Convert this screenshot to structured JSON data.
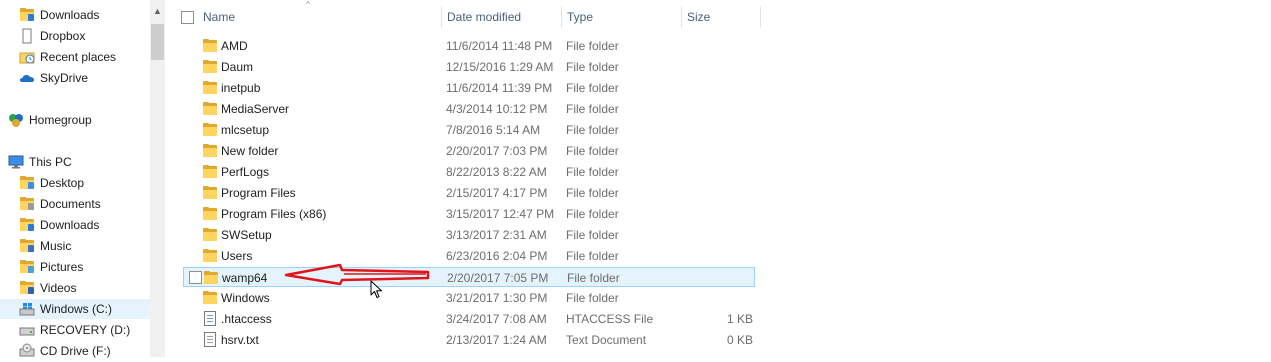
{
  "nav_pane": {
    "items": [
      {
        "label": "Downloads",
        "icon": "downloads-folder-icon"
      },
      {
        "label": "Dropbox",
        "icon": "dropbox-icon"
      },
      {
        "label": "Recent places",
        "icon": "recent-places-icon"
      },
      {
        "label": "SkyDrive",
        "icon": "skydrive-icon"
      },
      {
        "label": "Homegroup",
        "icon": "homegroup-icon"
      },
      {
        "label": "This PC",
        "icon": "this-pc-icon"
      },
      {
        "label": "Desktop",
        "icon": "desktop-folder-icon"
      },
      {
        "label": "Documents",
        "icon": "documents-folder-icon"
      },
      {
        "label": "Downloads",
        "icon": "downloads-folder-icon"
      },
      {
        "label": "Music",
        "icon": "music-folder-icon"
      },
      {
        "label": "Pictures",
        "icon": "pictures-folder-icon"
      },
      {
        "label": "Videos",
        "icon": "videos-folder-icon"
      },
      {
        "label": "Windows (C:)",
        "icon": "windows-drive-icon",
        "selected": true
      },
      {
        "label": "RECOVERY (D:)",
        "icon": "drive-icon"
      },
      {
        "label": "CD Drive (F:)",
        "icon": "cd-drive-icon"
      }
    ],
    "scroll_up_glyph": "▲"
  },
  "file_list": {
    "columns": {
      "name": "Name",
      "date_modified": "Date modified",
      "type": "Type",
      "size": "Size"
    },
    "sort_glyph": "^",
    "rows": [
      {
        "name": "AMD",
        "date": "11/6/2014 11:48 PM",
        "type": "File folder",
        "size": "",
        "icon": "folder-icon"
      },
      {
        "name": "Daum",
        "date": "12/15/2016 1:29 AM",
        "type": "File folder",
        "size": "",
        "icon": "folder-icon"
      },
      {
        "name": "inetpub",
        "date": "11/6/2014 11:39 PM",
        "type": "File folder",
        "size": "",
        "icon": "folder-icon"
      },
      {
        "name": "MediaServer",
        "date": "4/3/2014 10:12 PM",
        "type": "File folder",
        "size": "",
        "icon": "folder-icon"
      },
      {
        "name": "mlcsetup",
        "date": "7/8/2016 5:14 AM",
        "type": "File folder",
        "size": "",
        "icon": "folder-icon"
      },
      {
        "name": "New folder",
        "date": "2/20/2017 7:03 PM",
        "type": "File folder",
        "size": "",
        "icon": "folder-icon"
      },
      {
        "name": "PerfLogs",
        "date": "8/22/2013 8:22 AM",
        "type": "File folder",
        "size": "",
        "icon": "folder-icon"
      },
      {
        "name": "Program Files",
        "date": "2/15/2017 4:17 PM",
        "type": "File folder",
        "size": "",
        "icon": "folder-icon"
      },
      {
        "name": "Program Files (x86)",
        "date": "3/15/2017 12:47 PM",
        "type": "File folder",
        "size": "",
        "icon": "folder-icon"
      },
      {
        "name": "SWSetup",
        "date": "3/13/2017 2:31 AM",
        "type": "File folder",
        "size": "",
        "icon": "folder-icon"
      },
      {
        "name": "Users",
        "date": "6/23/2016 2:04 PM",
        "type": "File folder",
        "size": "",
        "icon": "folder-icon"
      },
      {
        "name": "wamp64",
        "date": "2/20/2017 7:05 PM",
        "type": "File folder",
        "size": "",
        "icon": "folder-icon",
        "selected": true
      },
      {
        "name": "Windows",
        "date": "3/21/2017 1:30 PM",
        "type": "File folder",
        "size": "",
        "icon": "folder-icon"
      },
      {
        "name": ".htaccess",
        "date": "3/24/2017 7:08 AM",
        "type": "HTACCESS File",
        "size": "1 KB",
        "icon": "file-icon"
      },
      {
        "name": "hsrv.txt",
        "date": "2/13/2017 1:24 AM",
        "type": "Text Document",
        "size": "0 KB",
        "icon": "text-file-icon"
      }
    ]
  },
  "annotation": {
    "type": "red-arrow",
    "points_to": "wamp64",
    "color": "#e0141b"
  },
  "colors": {
    "selection_bg": "#e5f3ff",
    "selection_border": "#99d1ff",
    "header_text": "#4c607a",
    "folder_yellow": "#ffd461"
  }
}
